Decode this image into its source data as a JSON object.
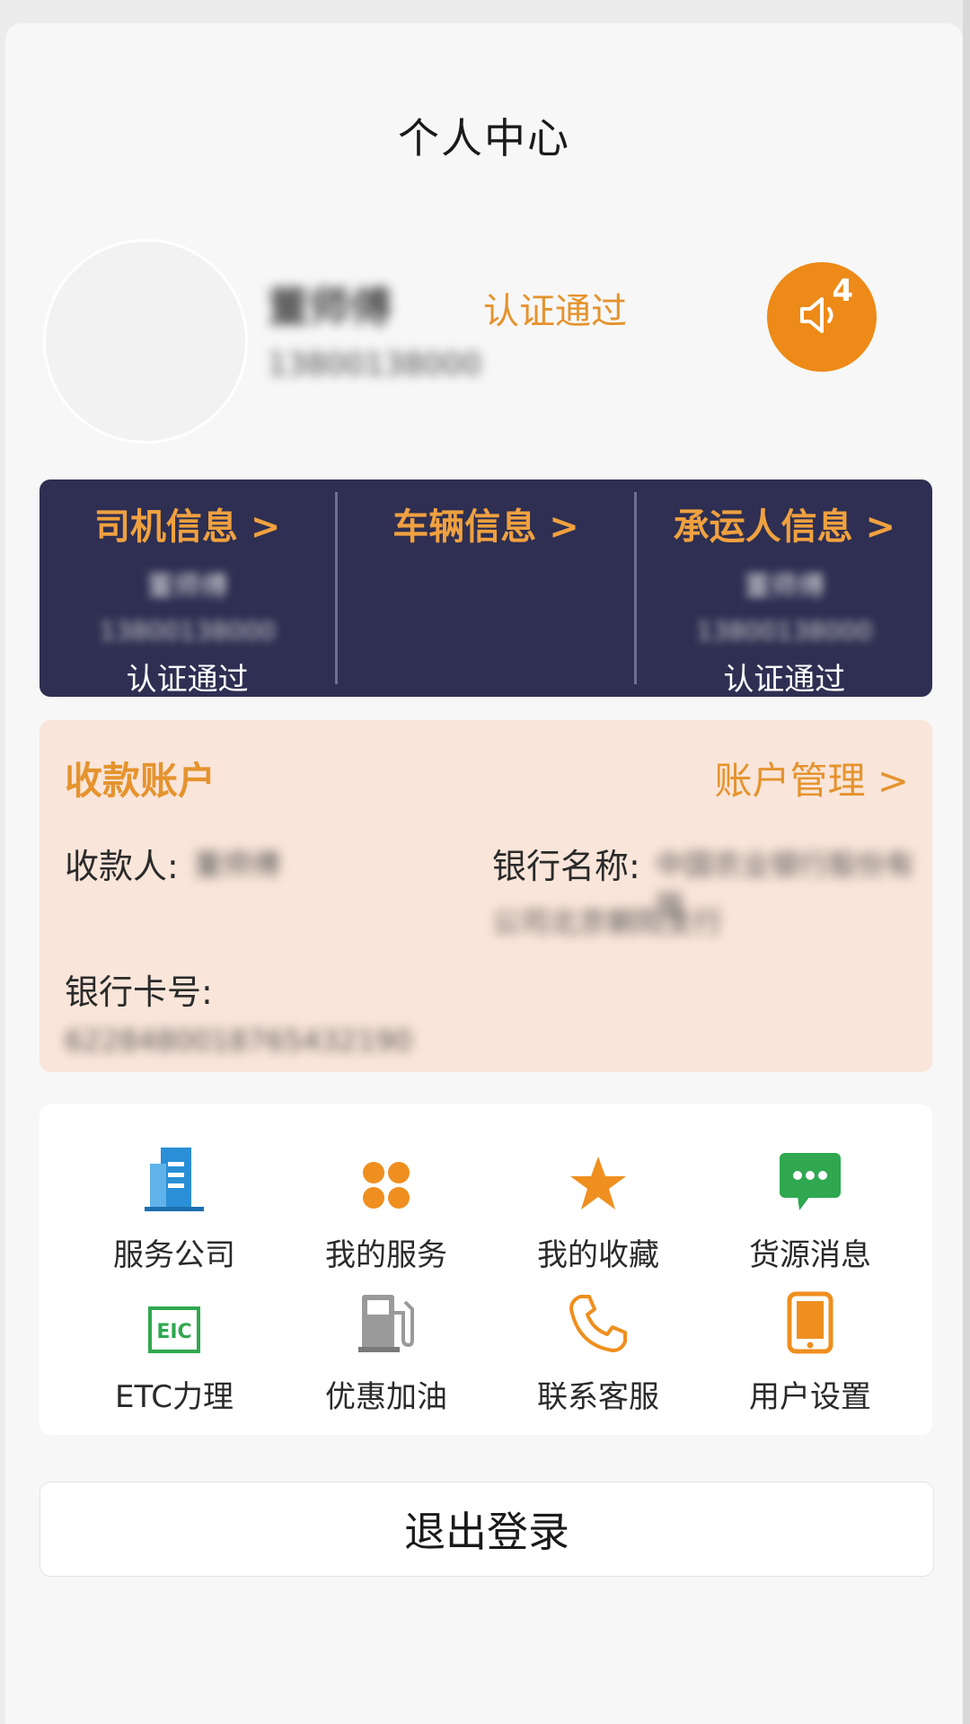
{
  "header": {
    "title": "个人中心"
  },
  "profile": {
    "name": "董师傅",
    "phone": "13800138000",
    "auth_status": "认证通过",
    "message_count": "4",
    "message_icon": "speaker-icon"
  },
  "info_cards": [
    {
      "title": "司机信息 >",
      "line1": "董师傅",
      "line2": "13800138000",
      "status": "认证通过"
    },
    {
      "title": "车辆信息 >",
      "line1": "",
      "line2": "",
      "status": ""
    },
    {
      "title": "承运人信息 >",
      "line1": "董师傅",
      "line2": "13800138000",
      "status": "认证通过"
    }
  ],
  "account": {
    "title": "收款账户",
    "manage": "账户管理 >",
    "payee_label": "收款人:",
    "payee_value": "董师傅",
    "bank_name_label": "银行名称:",
    "bank_name_value_1": "中国农业银行股份有限",
    "bank_name_value_2": "公司北京朝阳支行",
    "card_no_label": "银行卡号:",
    "card_no_value": "6228480018765432190"
  },
  "services": [
    {
      "label": "服务公司",
      "icon": "building-icon"
    },
    {
      "label": "我的服务",
      "icon": "four-dots-icon"
    },
    {
      "label": "我的收藏",
      "icon": "star-icon"
    },
    {
      "label": "货源消息",
      "icon": "chat-bubble-icon"
    },
    {
      "label": "ETC力理",
      "icon": "etc-icon"
    },
    {
      "label": "优惠加油",
      "icon": "fuel-pump-icon"
    },
    {
      "label": "联系客服",
      "icon": "phone-icon"
    },
    {
      "label": "用户设置",
      "icon": "tablet-icon"
    }
  ],
  "logout": {
    "label": "退出登录"
  },
  "colors": {
    "accent": "#ee8a17",
    "info_card_bg": "#2e2f52",
    "account_card_bg": "#f9e5d9",
    "blue_icon": "#2a8fd6",
    "green_icon": "#2fa84f"
  }
}
